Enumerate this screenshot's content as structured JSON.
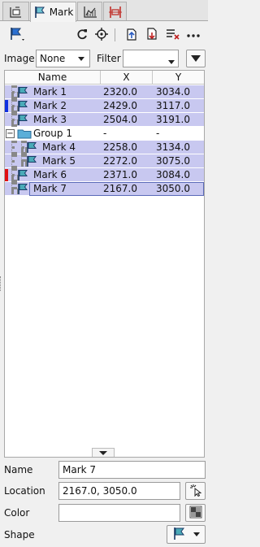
{
  "tabs": [
    {
      "name": "layers",
      "icon": "layers-icon"
    },
    {
      "name": "mark",
      "icon": "flag-icon",
      "label": "Mark"
    },
    {
      "name": "chart",
      "icon": "chart-icon"
    },
    {
      "name": "measure",
      "icon": "ruler-icon"
    }
  ],
  "toolbar": {
    "icons": [
      "flag-dropdown-icon",
      "refresh-icon",
      "crosshair-icon",
      "import-icon",
      "export-icon",
      "clear-list-icon",
      "more-icon"
    ]
  },
  "filter_row": {
    "image_label": "Image",
    "image_value": "None",
    "filter_label": "Filter",
    "filter_value": ""
  },
  "table": {
    "columns": [
      "Name",
      "X",
      "Y"
    ],
    "rows": [
      {
        "name": "Mark 1",
        "x": "2320.0",
        "y": "3034.0",
        "level": 0,
        "type": "mark",
        "color": ""
      },
      {
        "name": "Mark 2",
        "x": "2429.0",
        "y": "3117.0",
        "level": 0,
        "type": "mark",
        "color": "#1030e0"
      },
      {
        "name": "Mark 3",
        "x": "2504.0",
        "y": "3191.0",
        "level": 0,
        "type": "mark",
        "color": ""
      },
      {
        "name": "Group 1",
        "x": "-",
        "y": "-",
        "level": 0,
        "type": "group",
        "color": ""
      },
      {
        "name": "Mark 4",
        "x": "2258.0",
        "y": "3134.0",
        "level": 1,
        "type": "mark",
        "color": ""
      },
      {
        "name": "Mark 5",
        "x": "2272.0",
        "y": "3075.0",
        "level": 1,
        "type": "mark",
        "color": ""
      },
      {
        "name": "Mark 6",
        "x": "2371.0",
        "y": "3084.0",
        "level": 0,
        "type": "mark",
        "color": "#e01010"
      },
      {
        "name": "Mark 7",
        "x": "2167.0",
        "y": "3050.0",
        "level": 0,
        "type": "mark",
        "color": "",
        "selected": true
      }
    ]
  },
  "properties": {
    "name_label": "Name",
    "name_value": "Mark 7",
    "location_label": "Location",
    "location_value": "2167.0, 3050.0",
    "color_label": "Color",
    "color_value": "",
    "shape_label": "Shape"
  }
}
